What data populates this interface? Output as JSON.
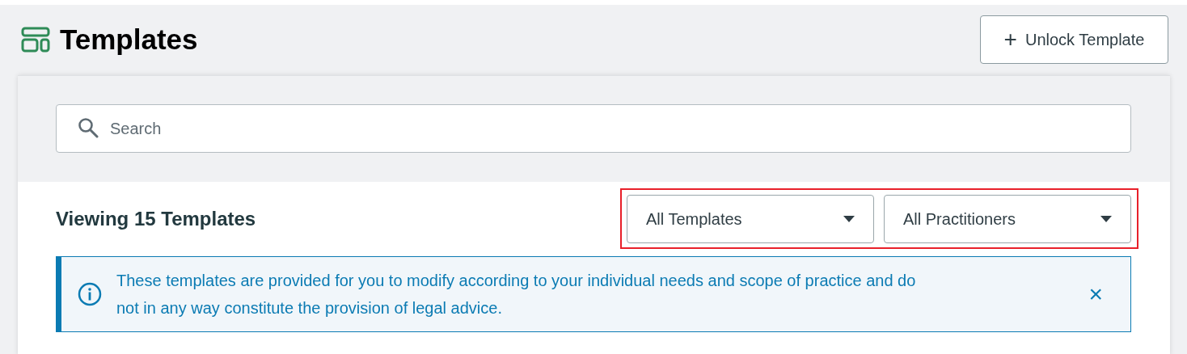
{
  "header": {
    "title": "Templates",
    "action_button": {
      "icon": "+",
      "label": "Unlock Template"
    }
  },
  "search": {
    "placeholder": "Search"
  },
  "listing": {
    "heading": "Viewing 15 Templates",
    "filters_highlighted": true,
    "filters": [
      {
        "value": "All Templates"
      },
      {
        "value": "All Practitioners"
      }
    ]
  },
  "notice": {
    "text": "These templates are provided for you to modify according to your individual needs and scope of practice and do not in any way constitute the provision of legal advice.",
    "close": "×"
  }
}
